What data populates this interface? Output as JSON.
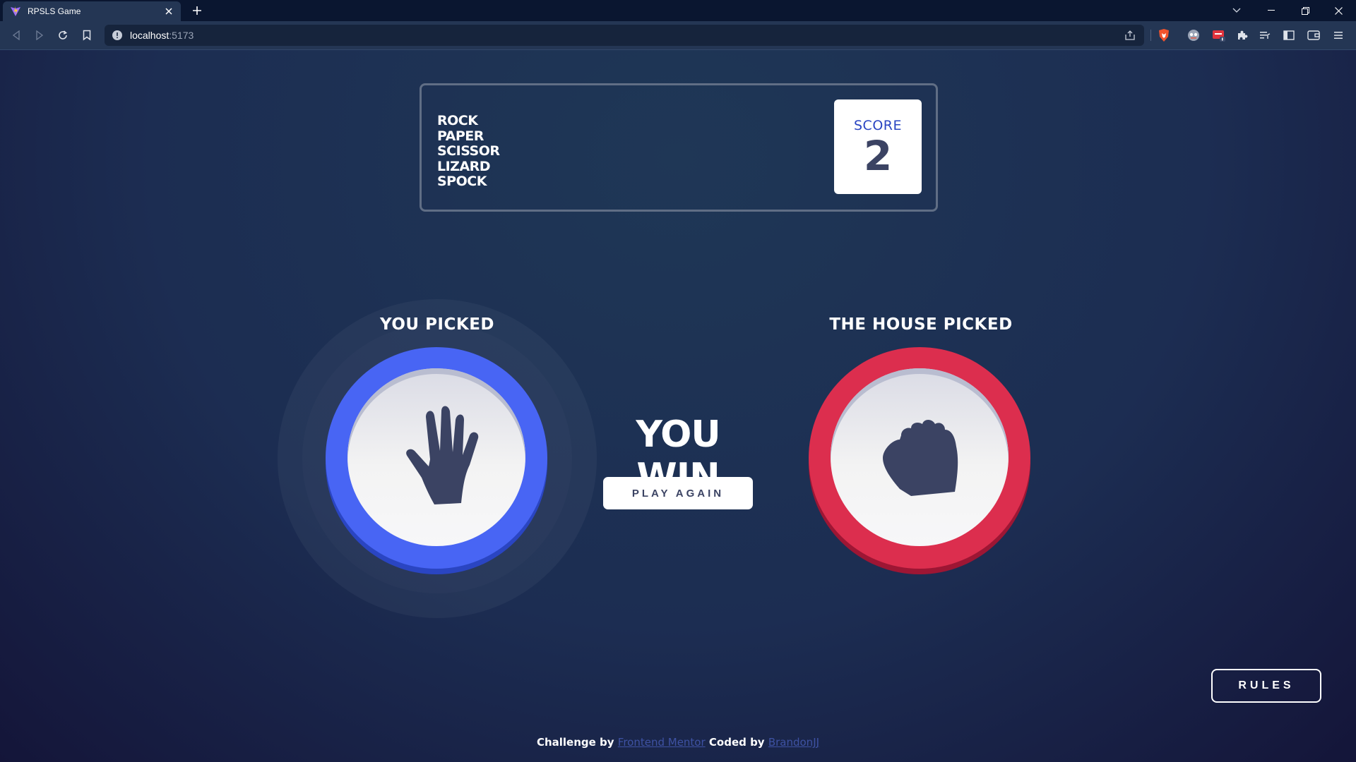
{
  "browser": {
    "tab_title": "RPSLS Game",
    "url_host": "localhost",
    "url_port": ":5173"
  },
  "header": {
    "title_lines": [
      "ROCK",
      "PAPER",
      "SCISSOR",
      "LIZARD",
      "SPOCK"
    ],
    "score_label": "SCORE",
    "score_value": "2"
  },
  "player": {
    "label": "YOU PICKED",
    "choice_icon": "paper-hand-icon",
    "ring_color": "#4865f4",
    "ring_shadow": "#2a45c2"
  },
  "house": {
    "label": "THE HOUSE PICKED",
    "choice_icon": "rock-fist-icon",
    "ring_color": "#dc2e4e",
    "ring_shadow": "#9d1634"
  },
  "result": {
    "text": "YOU WIN",
    "play_again_label": "PLAY AGAIN"
  },
  "rules_label": "RULES",
  "footer": {
    "challenge_prefix": "Challenge by",
    "challenge_link": "Frontend Mentor",
    "coded_prefix": "Coded by",
    "coded_link": "BrandonJJ"
  },
  "colors": {
    "icon_dark": "#3b4363",
    "score_text": "#2a45c2"
  }
}
